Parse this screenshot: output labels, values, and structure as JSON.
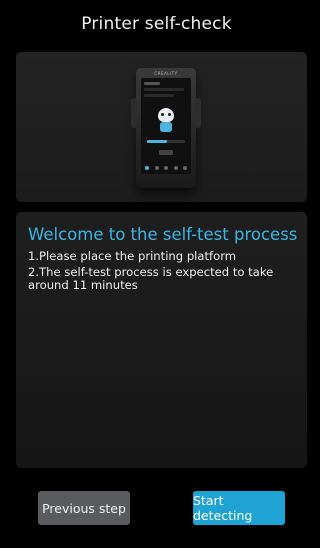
{
  "header": {
    "title": "Printer self-check"
  },
  "illustration": {
    "brand_text": "CREALITY"
  },
  "intro": {
    "heading": "Welcome to the self-test process",
    "steps": [
      "1.Please place the printing platform",
      "2.The self-test process is expected to take around 11 minutes"
    ]
  },
  "footer": {
    "previous_label": "Previous step",
    "start_label": "Start detecting"
  },
  "colors": {
    "background": "#000000",
    "accent": "#1fa3d4",
    "heading": "#3ab6e6",
    "secondary_button": "#5a5b5e"
  }
}
